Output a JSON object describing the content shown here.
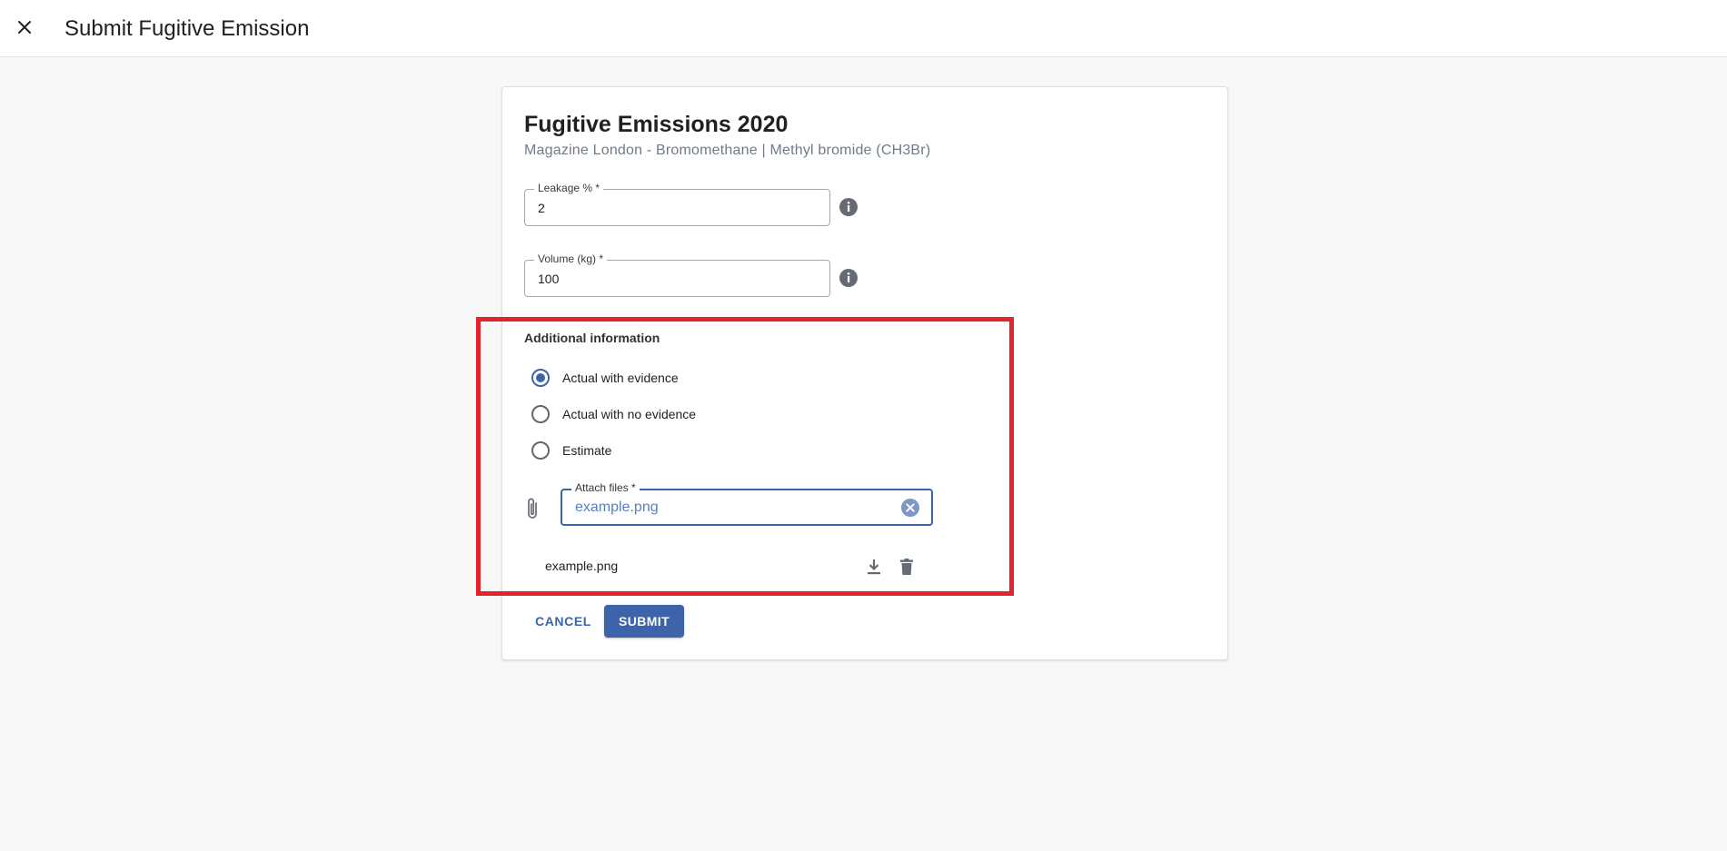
{
  "header": {
    "title": "Submit Fugitive Emission"
  },
  "form": {
    "title": "Fugitive Emissions 2020",
    "subtitle": "Magazine London - Bromomethane | Methyl bromide (CH3Br)",
    "leakage": {
      "label": "Leakage % *",
      "value": "2"
    },
    "volume": {
      "label": "Volume (kg) *",
      "value": "100"
    },
    "additional_info": {
      "label": "Additional information",
      "options": [
        {
          "label": "Actual with evidence",
          "selected": true
        },
        {
          "label": "Actual with no evidence",
          "selected": false
        },
        {
          "label": "Estimate",
          "selected": false
        }
      ]
    },
    "attach": {
      "label": "Attach files *",
      "value": "example.png"
    },
    "files": [
      {
        "name": "example.png"
      }
    ],
    "cancel_label": "CANCEL",
    "submit_label": "SUBMIT"
  },
  "colors": {
    "primary": "#3d64aa",
    "highlight": "#e3242b",
    "icon": "#666b73"
  },
  "icons": {
    "close": "close-icon",
    "info": "info-icon",
    "attach": "paperclip-icon",
    "clear": "clear-circle-icon",
    "download": "download-icon",
    "delete": "trash-icon"
  }
}
